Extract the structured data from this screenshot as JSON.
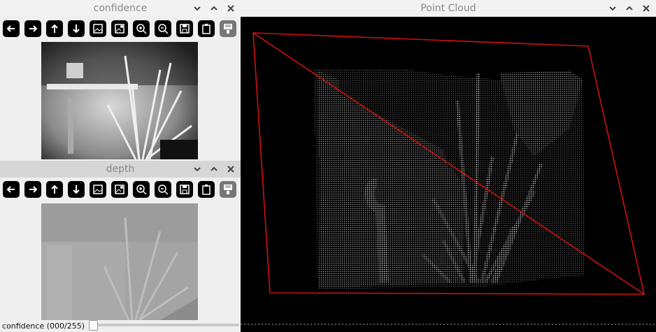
{
  "windows": {
    "confidence": {
      "title": "confidence"
    },
    "depth": {
      "title": "depth"
    },
    "pointcloud": {
      "title": "Point Cloud"
    }
  },
  "toolbar_icons": [
    "arrow-left-icon",
    "arrow-right-icon",
    "arrow-up-icon",
    "arrow-down-icon",
    "image-icon",
    "image-settings-icon",
    "zoom-in-icon",
    "zoom-out-icon",
    "save-icon",
    "clipboard-icon",
    "properties-icon"
  ],
  "slider": {
    "label": "confidence (000/255)",
    "value": 0,
    "max": 255
  },
  "colors": {
    "bbox": "#d01010",
    "titlebar_text": "#8a8a8a"
  }
}
